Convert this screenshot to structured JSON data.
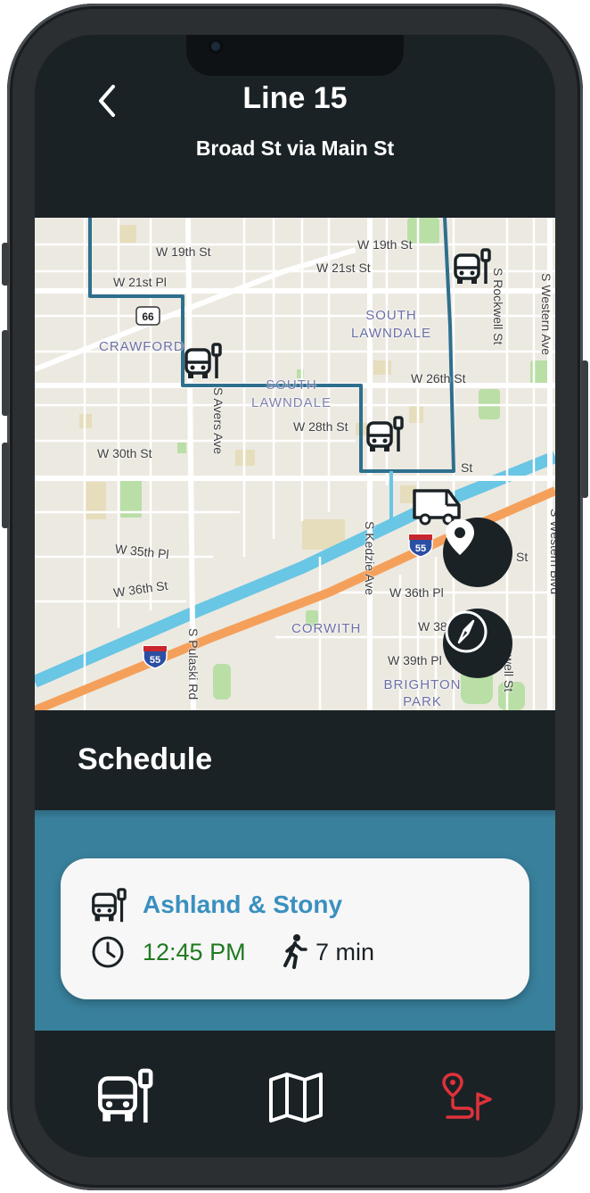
{
  "header": {
    "title": "Line 15",
    "subtitle": "Broad St via Main St"
  },
  "map": {
    "street_labels": [
      "W 19th St",
      "W 19th St",
      "W 21st St",
      "W 21st Pl",
      "W 26th St",
      "W 28th St",
      "W 30th St",
      "W 35th Pl",
      "W 36th St",
      "W 36th Pl",
      "W 38",
      "W 39th Pl",
      "St",
      "St",
      "S Avers Ave",
      "S Kedzie Ave",
      "S Pulaski Rd",
      "S Rockwell St",
      "S Western Ave",
      "S Western Blvd",
      "well St"
    ],
    "area_labels": [
      "SOUTH LAWNDALE",
      "SOUTH LAWNDALE",
      "CRAWFORD",
      "CORWITH",
      "BRIGHTON PARK"
    ],
    "shields": [
      "66",
      "55",
      "55"
    ],
    "route_color": "#2f6f8e",
    "buttons": {
      "location": "location-pin-icon",
      "compass": "compass-icon"
    }
  },
  "schedule": {
    "title": "Schedule",
    "items": [
      {
        "stop": "Ashland & Stony",
        "time": "12:45 PM",
        "walk": "7 min"
      }
    ]
  },
  "nav": {
    "items": [
      {
        "icon": "bus-stop-icon",
        "active": false
      },
      {
        "icon": "map-icon",
        "active": false
      },
      {
        "icon": "route-icon",
        "active": true
      }
    ],
    "active_color": "#e0323a"
  },
  "colors": {
    "dark": "#1b2226",
    "accent_blue": "#39809c",
    "stop_name": "#3a90c0",
    "time_green": "#1f7a1f"
  }
}
